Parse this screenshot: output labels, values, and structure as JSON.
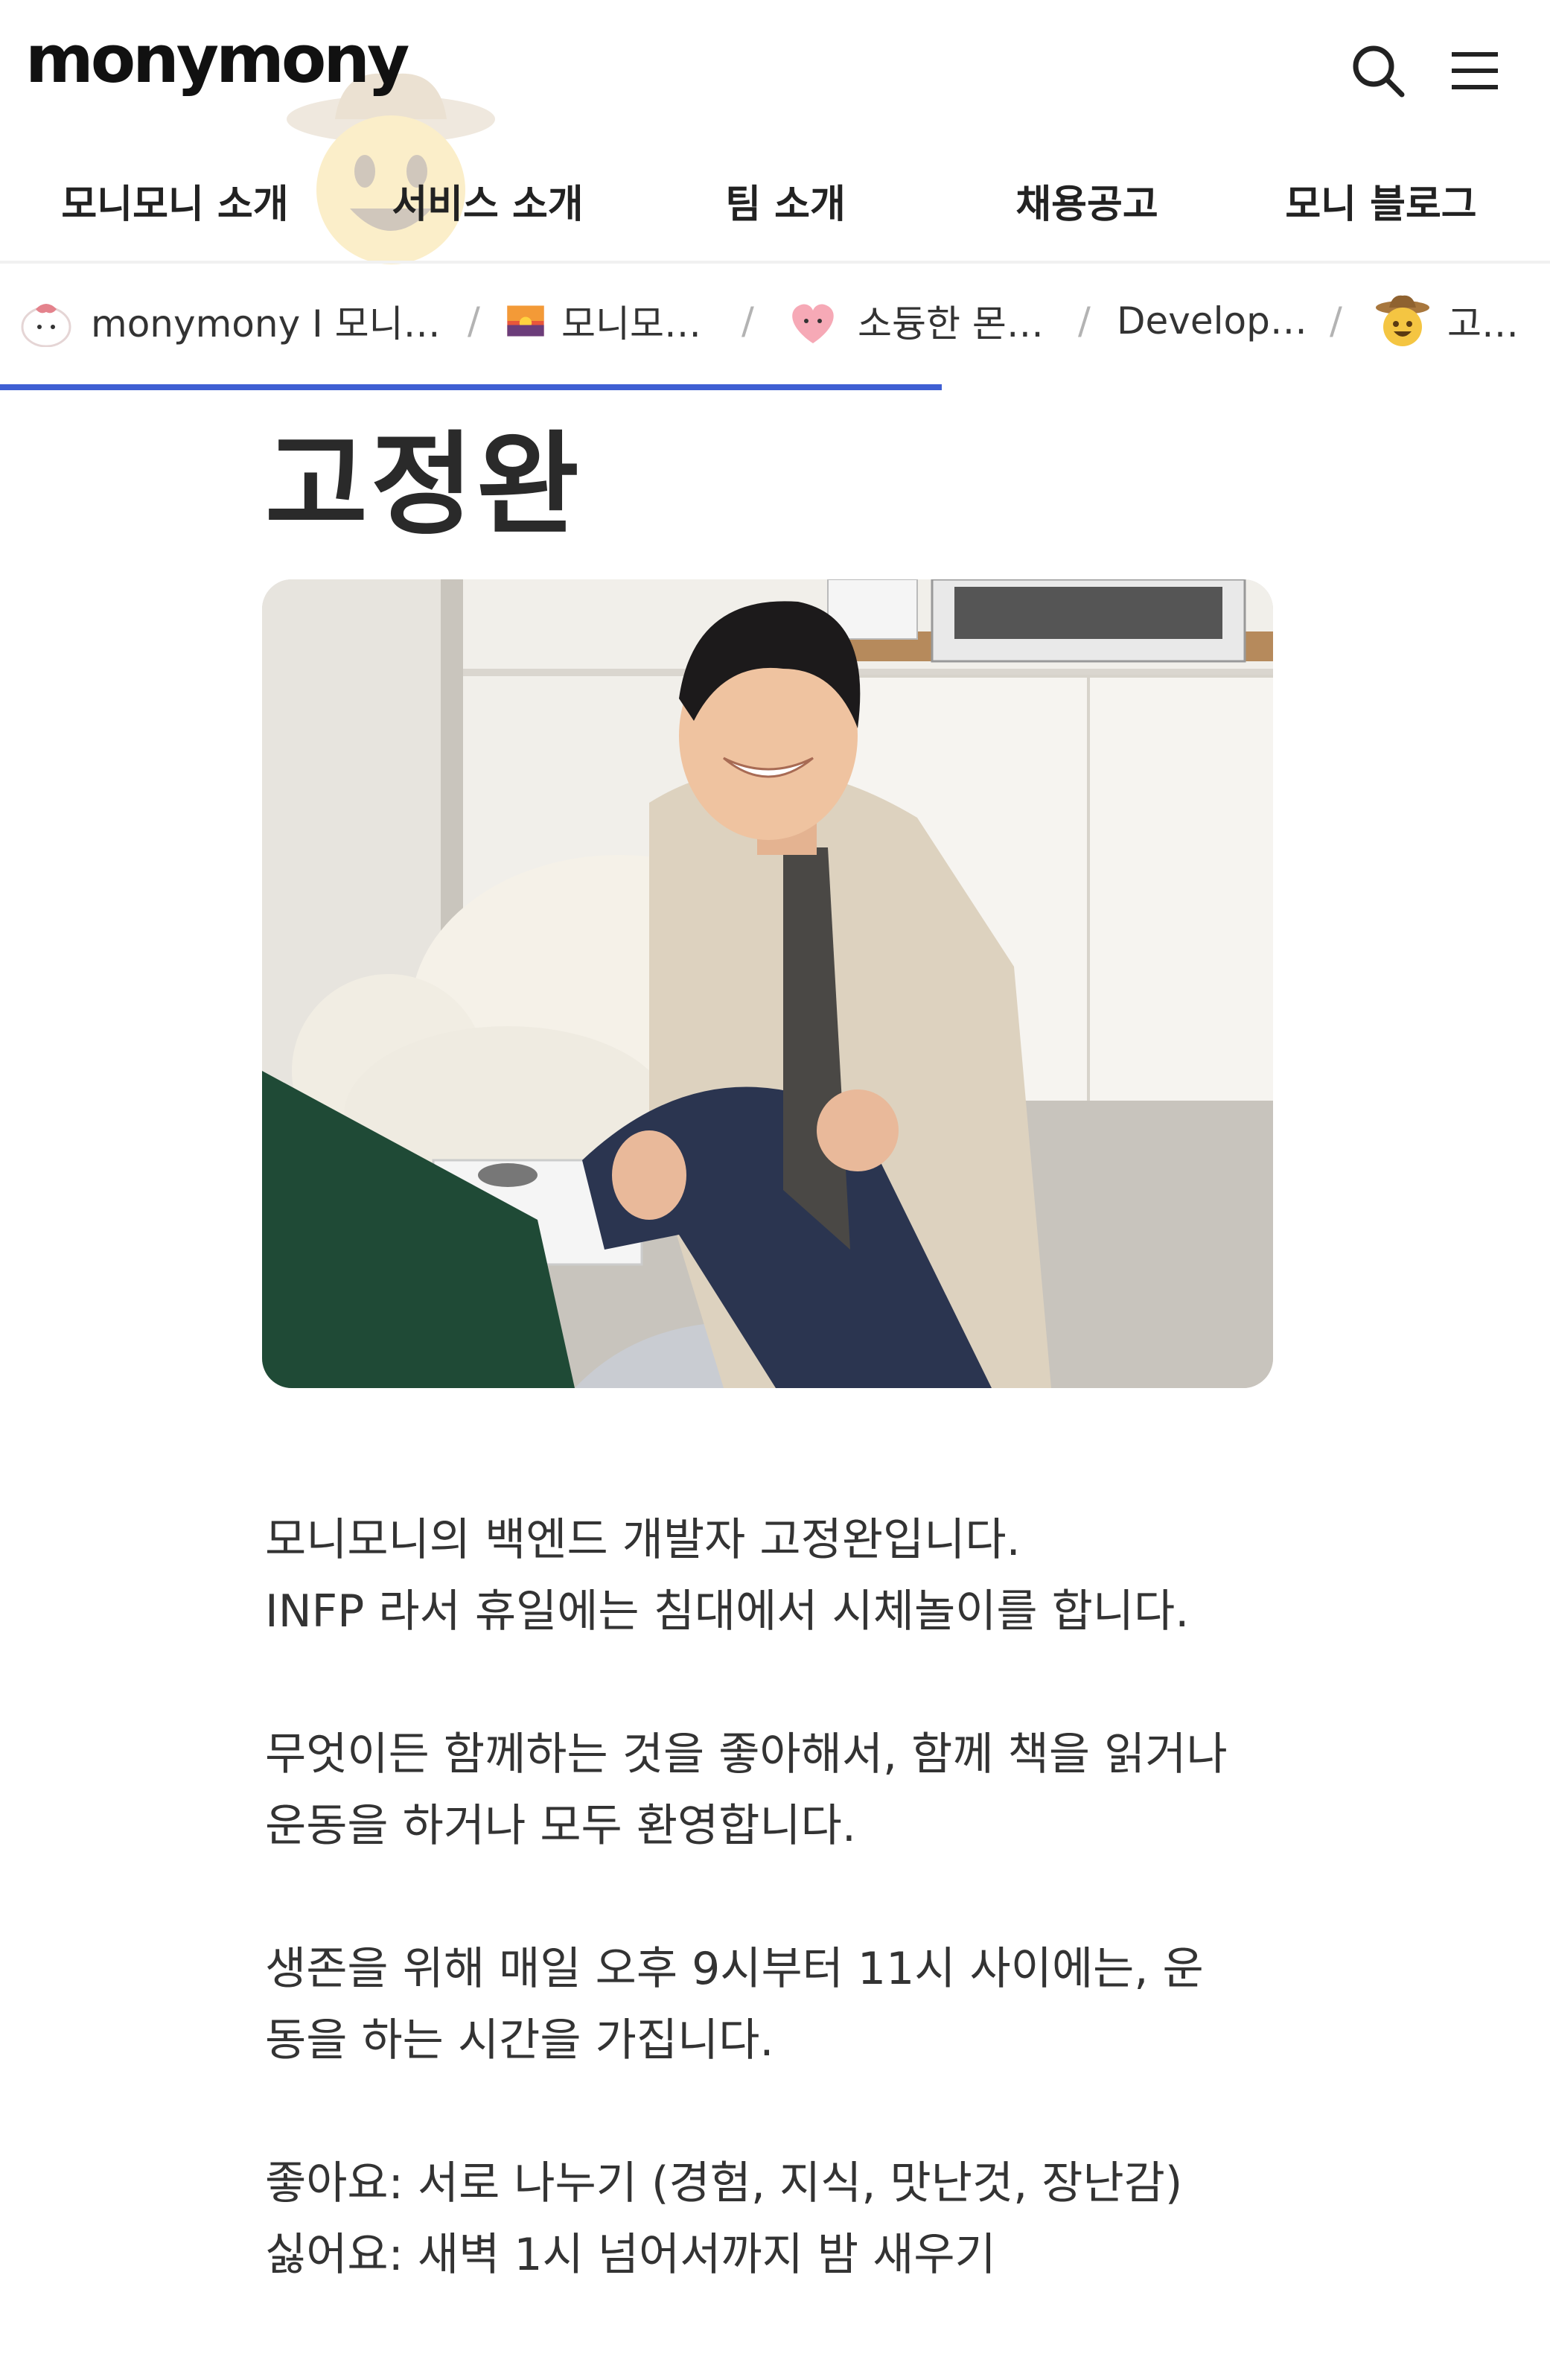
{
  "header": {
    "logo": "monymony",
    "nav": [
      {
        "label": "모니모니 소개"
      },
      {
        "label": "서비스 소개"
      },
      {
        "label": "팀 소개"
      },
      {
        "label": "채용공고"
      },
      {
        "label": "모니 블로그"
      }
    ]
  },
  "breadcrumb": {
    "items": [
      {
        "label": "monymony I 모니…",
        "icon": "cat-character-icon"
      },
      {
        "label": "모니모…",
        "icon": "sunset-icon"
      },
      {
        "label": "소듕한 몬…",
        "icon": "pink-face-icon"
      },
      {
        "label": "Develop…",
        "icon": ""
      },
      {
        "label": "고…",
        "icon": "cowboy-smile-icon"
      }
    ],
    "separator": "/",
    "reading_progress": 0.62
  },
  "page": {
    "title": "고정완",
    "paragraphs": [
      "모니모니의 백엔드 개발자 고정완입니다.\nINFP 라서 휴일에는 침대에서 시체놀이를 합니다.",
      "무엇이든 함께하는 것을 좋아해서, 함께 책을 읽거나\n운동을 하거나 모두 환영합니다.",
      "생존을 위해 매일 오후 9시부터 11시 사이에는, 운\n동을 하는 시간을 가집니다.",
      "좋아요: 서로 나누기 (경험, 지식, 맛난것, 장난감)\n싫어요: 새벽 1시 넘어서까지 밤 새우기"
    ]
  },
  "colors": {
    "accent": "#3f5fd3",
    "text": "#333333"
  }
}
